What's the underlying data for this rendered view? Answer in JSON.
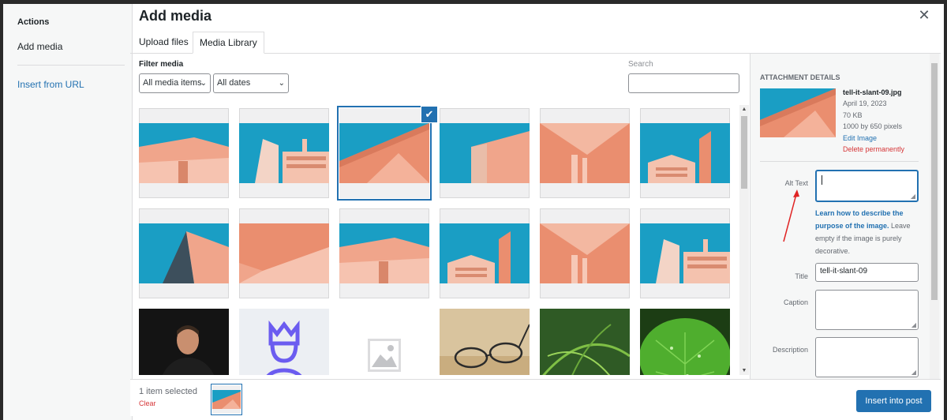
{
  "menu": {
    "title": "Actions",
    "add_media": "Add media",
    "insert_from_url": "Insert from URL"
  },
  "header": {
    "title": "Add media",
    "close_icon": "close-icon"
  },
  "tabs": [
    {
      "label": "Upload files",
      "active": false
    },
    {
      "label": "Media Library",
      "active": true
    }
  ],
  "toolbar": {
    "filter_label": "Filter media",
    "media_type_selected": "All media items",
    "date_selected": "All dates",
    "search_label": "Search",
    "search_value": ""
  },
  "grid": {
    "items": [
      {
        "kind": "architecture",
        "variant": 0,
        "selected": false
      },
      {
        "kind": "architecture",
        "variant": 1,
        "selected": false
      },
      {
        "kind": "architecture",
        "variant": 2,
        "selected": true
      },
      {
        "kind": "architecture",
        "variant": 3,
        "selected": false
      },
      {
        "kind": "architecture",
        "variant": 4,
        "selected": false
      },
      {
        "kind": "architecture",
        "variant": 5,
        "selected": false
      },
      {
        "kind": "architecture",
        "variant": 6,
        "selected": false
      },
      {
        "kind": "architecture",
        "variant": 7,
        "selected": false
      },
      {
        "kind": "architecture",
        "variant": 0,
        "selected": false
      },
      {
        "kind": "architecture",
        "variant": 5,
        "selected": false
      },
      {
        "kind": "architecture",
        "variant": 4,
        "selected": false
      },
      {
        "kind": "architecture",
        "variant": 1,
        "selected": false
      },
      {
        "kind": "portrait",
        "selected": false
      },
      {
        "kind": "crown-logo",
        "selected": false
      },
      {
        "kind": "placeholder",
        "selected": false
      },
      {
        "kind": "glasses",
        "selected": false
      },
      {
        "kind": "fern",
        "selected": false
      },
      {
        "kind": "leaf",
        "selected": false
      }
    ]
  },
  "attachment": {
    "heading": "Attachment Details",
    "filename": "tell-it-slant-09.jpg",
    "date": "April 19, 2023",
    "size": "70 KB",
    "dimensions": "1000 by 650 pixels",
    "edit_link": "Edit Image",
    "delete_link": "Delete permanently",
    "alt_text_label": "Alt Text",
    "alt_text_value": "",
    "help_link": "Learn how to describe the purpose of the image.",
    "help_text": " Leave empty if the image is purely decorative.",
    "title_label": "Title",
    "title_value": "tell-it-slant-09",
    "caption_label": "Caption",
    "caption_value": "",
    "description_label": "Description",
    "description_value": ""
  },
  "footer": {
    "selected_count": "1 item selected",
    "clear_label": "Clear",
    "insert_button": "Insert into post"
  },
  "colors": {
    "accent": "#2271b1",
    "danger": "#d63638",
    "sky": "#1a9ec4",
    "building": "#f0a58b"
  }
}
